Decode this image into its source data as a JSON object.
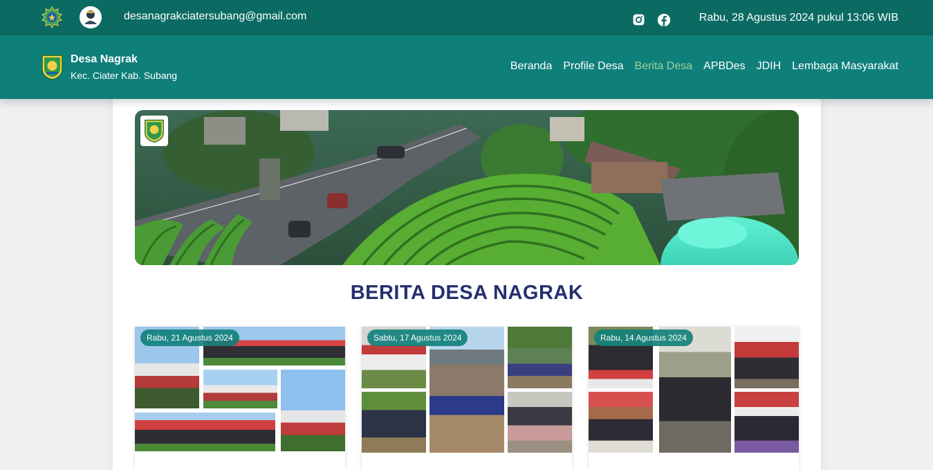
{
  "topbar": {
    "email": "desanagrakciatersubang@gmail.com",
    "datetime": "Rabu, 28 Agustus 2024 pukul 13:06 WIB",
    "icons": [
      "emblem-icon",
      "avatar",
      "instagram-icon",
      "facebook-icon"
    ]
  },
  "brand": {
    "name": "Desa Nagrak",
    "subtitle": "Kec. Ciater Kab. Subang"
  },
  "nav": {
    "items": [
      "Beranda",
      "Profile Desa",
      "Berita Desa",
      "APBDes",
      "JDIH",
      "Lembaga Masyarakat"
    ],
    "active": "Berita Desa",
    "active_color": "#9fd39a"
  },
  "page": {
    "section_title": "BERITA DESA NAGRAK"
  },
  "news": [
    {
      "date": "Rabu, 21 Agustus 2024"
    },
    {
      "date": "Sabtu, 17 Agustus 2024"
    },
    {
      "date": "Rabu, 14 Agustus 2024"
    }
  ],
  "colors": {
    "topbar": "#0b6b63",
    "navbar": "#0f7f7a",
    "title": "#24306e"
  }
}
